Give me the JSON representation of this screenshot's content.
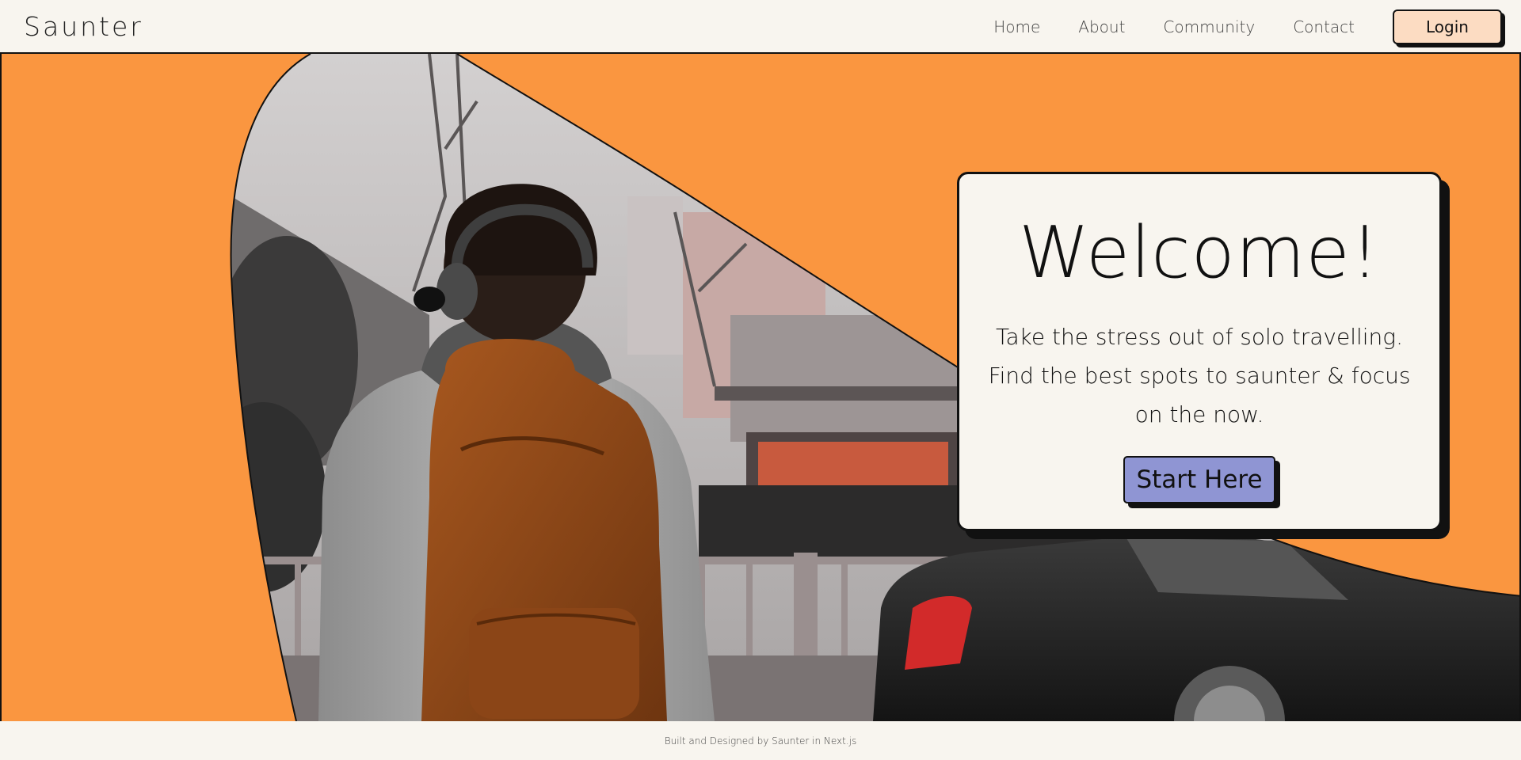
{
  "header": {
    "logo": "Saunter",
    "nav": [
      {
        "label": "Home"
      },
      {
        "label": "About"
      },
      {
        "label": "Community"
      },
      {
        "label": "Contact"
      }
    ],
    "login_label": "Login"
  },
  "hero": {
    "image": "photo of a traveller with headphones and a brown backpack on a city street",
    "welcome": {
      "title": "Welcome!",
      "text": "Take the stress out of solo travelling. Find the best spots to saunter & focus on the now.",
      "cta_label": "Start Here"
    }
  },
  "footer": {
    "text": "Built and Designed by Saunter in Next.js"
  },
  "colors": {
    "background": "#f8f5ef",
    "hero_orange": "#fa9640",
    "login_bg": "#fcdcc2",
    "cta_bg": "#8f95d3",
    "ink": "#111111"
  }
}
